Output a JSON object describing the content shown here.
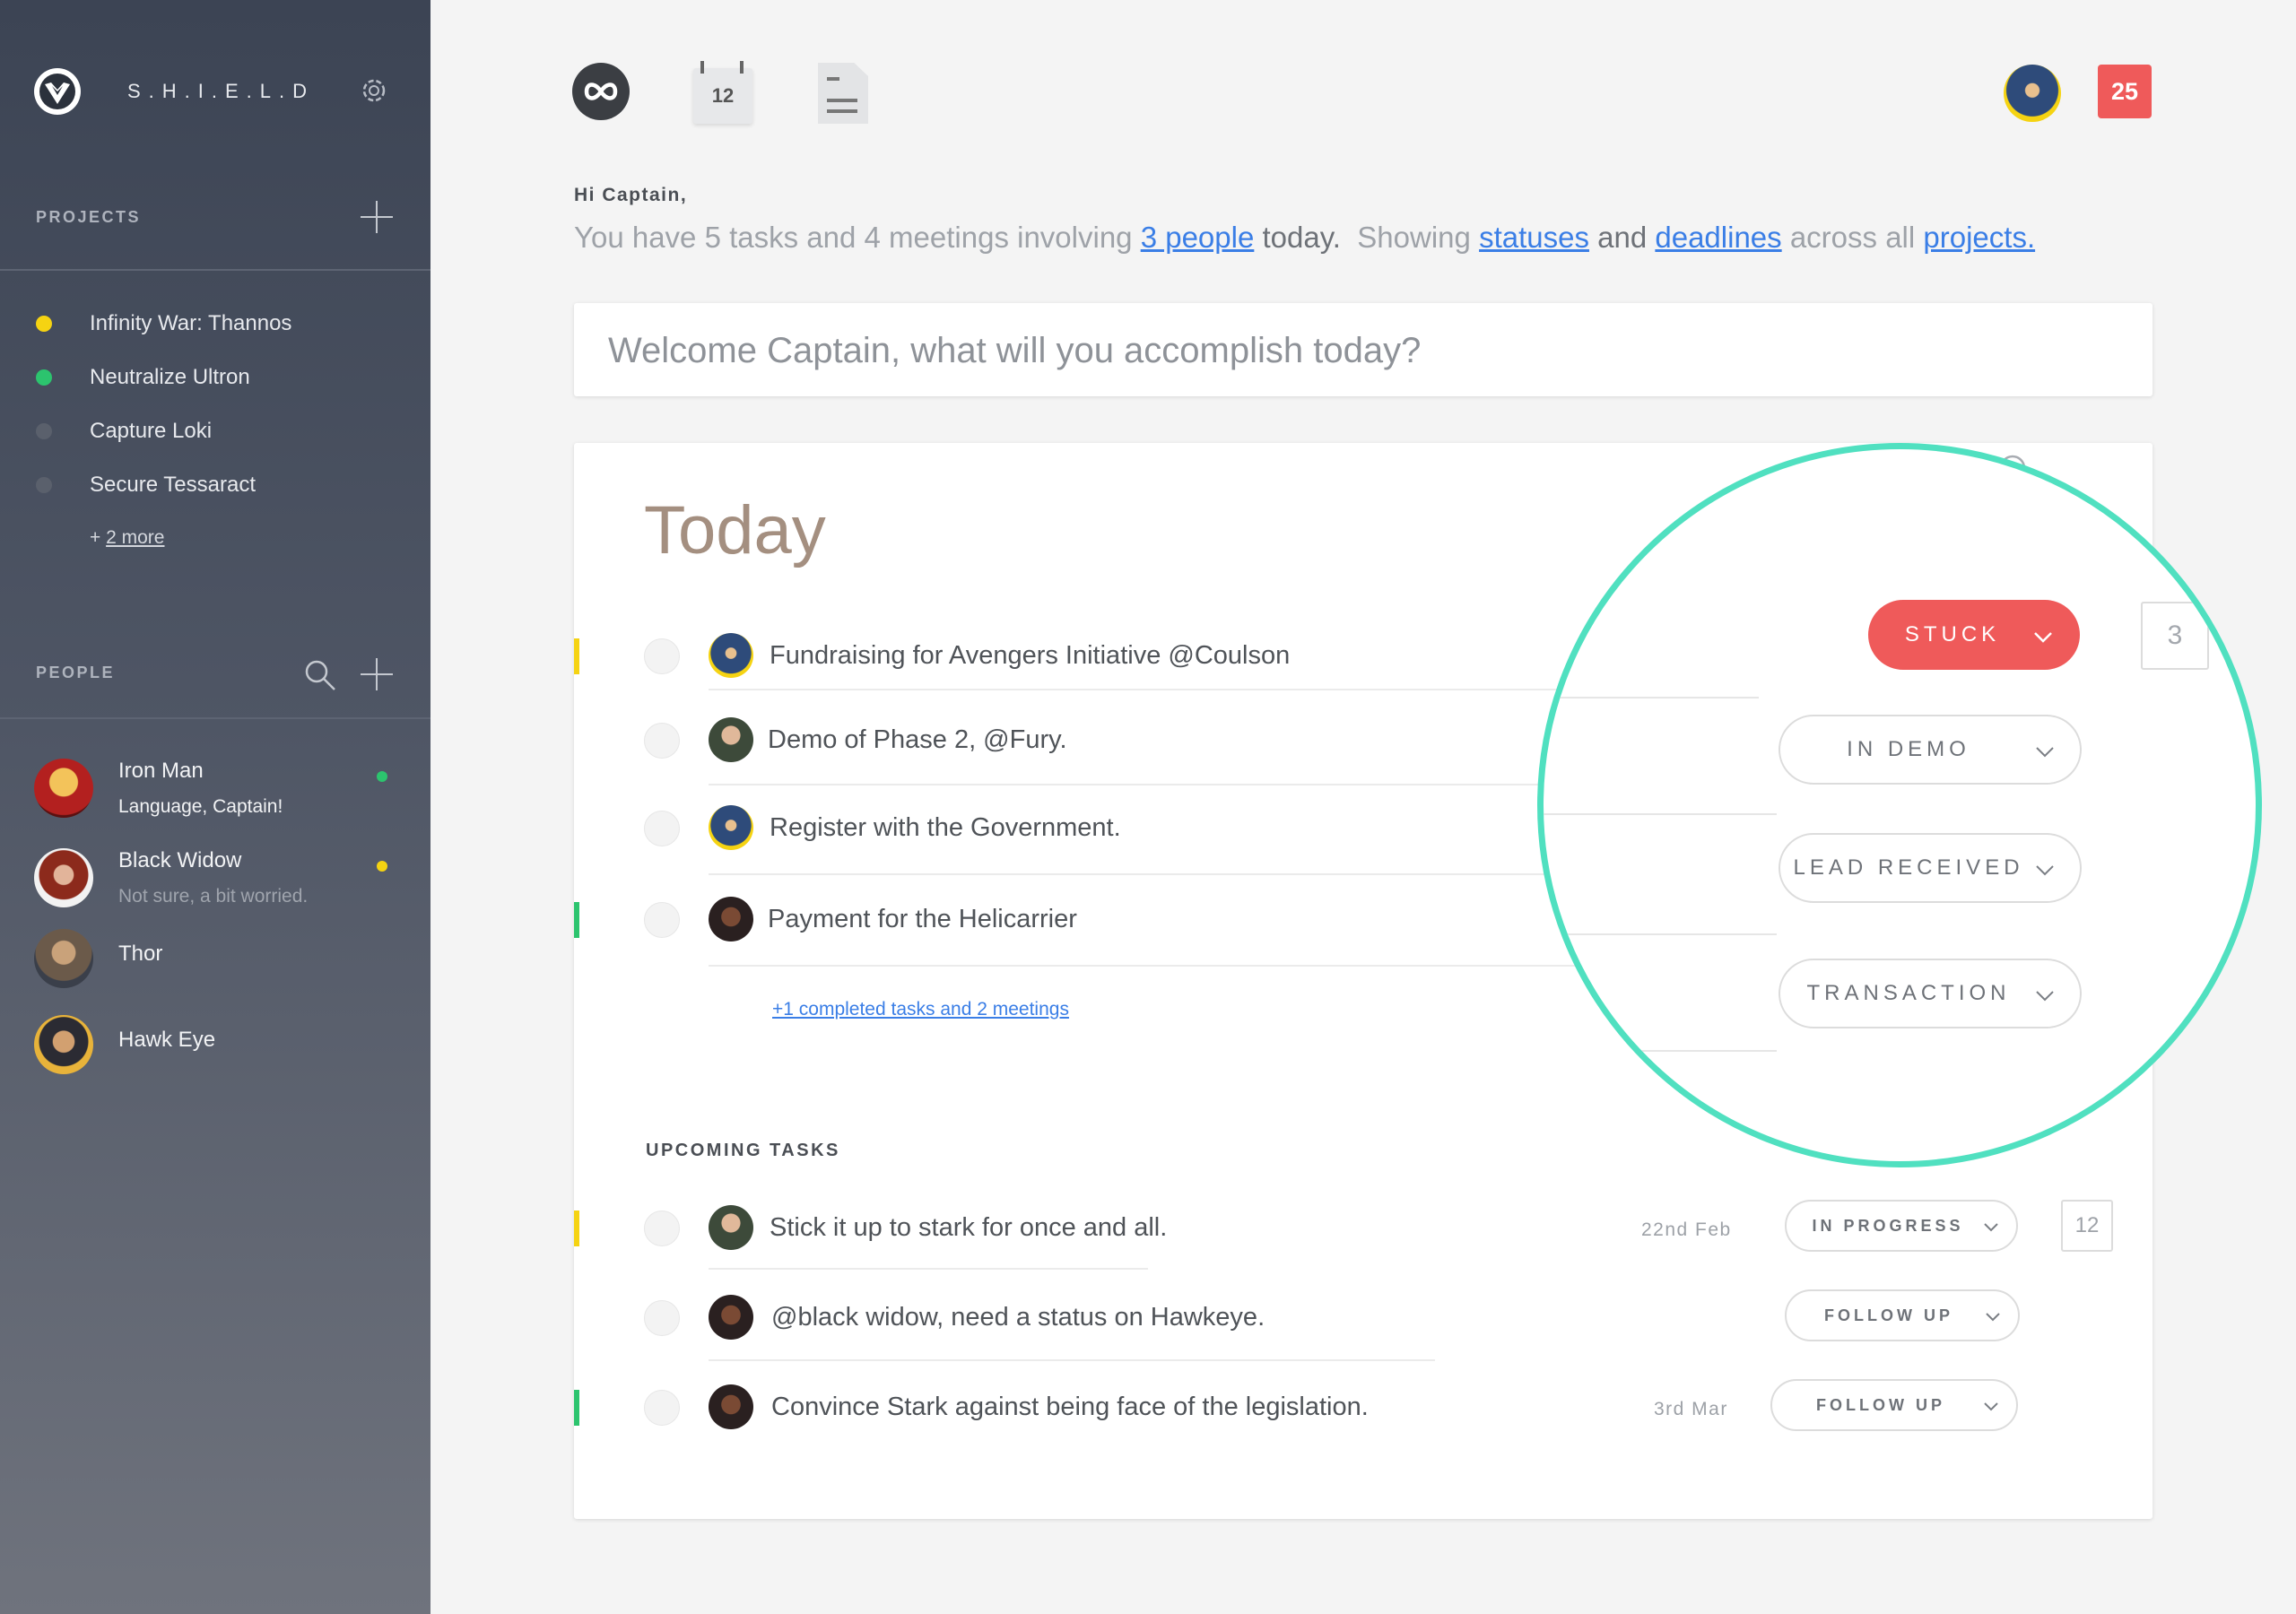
{
  "app": {
    "brand": "S.H.I.E.L.D"
  },
  "sidebar": {
    "projects_label": "PROJECTS",
    "projects": [
      {
        "name": "Infinity War: Thannos",
        "color": "#f5d312"
      },
      {
        "name": "Neutralize Ultron",
        "color": "#2cc46e"
      },
      {
        "name": "Capture Loki",
        "color": "#5a606c"
      },
      {
        "name": "Secure Tessaract",
        "color": "#5a606c"
      }
    ],
    "more_prefix": "+ ",
    "more_link": "2 more",
    "people_label": "PEOPLE",
    "people": [
      {
        "name": "Iron Man",
        "status": "Language, Captain!",
        "dot": "#2cc46e",
        "avatar": "iron-man"
      },
      {
        "name": "Black Widow",
        "status": "Not sure, a bit worried.",
        "dot": "#f5d312",
        "avatar": "black-widow"
      },
      {
        "name": "Thor",
        "status": "",
        "dot": "",
        "avatar": "thor"
      },
      {
        "name": "Hawk Eye",
        "status": "",
        "dot": "",
        "avatar": "hawk-eye"
      }
    ]
  },
  "topbar": {
    "calendar_day": "12",
    "notifications": "25",
    "icons": [
      "infinity-icon",
      "calendar-icon",
      "document-icon"
    ]
  },
  "greeting": {
    "hi": "Hi Captain,",
    "line_1": "You have 5 tasks and 4 meetings involving",
    "link_people": "3 people",
    "line_2": "today.",
    "line_3": "Showing",
    "link_statuses": "statuses",
    "line_4": "and",
    "link_deadlines": "deadlines",
    "line_5": "across all",
    "link_projects": "projects."
  },
  "input": {
    "placeholder": "Welcome Captain, what will you accomplish today?"
  },
  "today": {
    "title": "Today",
    "tasks": [
      {
        "text": "Fundraising for Avengers Initiative @Coulson",
        "accent": "#f5d312",
        "status": "STUCK",
        "count": "3"
      },
      {
        "text": "Demo of Phase 2, @Fury.",
        "accent": "",
        "status": "IN DEMO"
      },
      {
        "text": "Register with the Government.",
        "accent": "",
        "status": "LEAD RECEIVED"
      },
      {
        "text": "Payment for the Helicarrier",
        "accent": "#2cc46e",
        "status": "TRANSACTION"
      }
    ],
    "completed_link": "+1 completed tasks and 2 meetings"
  },
  "upcoming": {
    "title": "UPCOMING TASKS",
    "tasks": [
      {
        "text": "Stick it up to stark for once and all.",
        "date": "22nd Feb",
        "status": "IN PROGRESS",
        "count": "12",
        "accent": "#f5d312"
      },
      {
        "text": "@black widow, need a status on Hawkeye.",
        "date": "",
        "status": "FOLLOW UP",
        "accent": ""
      },
      {
        "text": "Convince Stark against being face of the legislation.",
        "date": "3rd Mar",
        "status": "FOLLOW UP",
        "accent": "#2cc46e"
      }
    ]
  },
  "colors": {
    "accent_teal": "#50e0c0",
    "stuck_red": "#ef5a5a",
    "link_blue": "#3a7ee6"
  }
}
